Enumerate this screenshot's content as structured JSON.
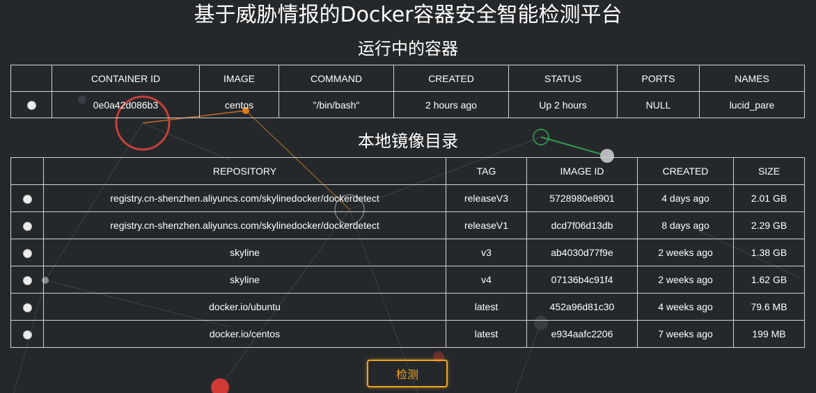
{
  "page": {
    "title": "基于威胁情报的Docker容器安全智能检测平台"
  },
  "containers": {
    "section_title": "运行中的容器",
    "headers": [
      "",
      "CONTAINER ID",
      "IMAGE",
      "COMMAND",
      "CREATED",
      "STATUS",
      "PORTS",
      "NAMES"
    ],
    "rows": [
      [
        "0e0a42d086b3",
        "centos",
        "\"/bin/bash\"",
        "2 hours ago",
        "Up 2 hours",
        "NULL",
        "lucid_pare"
      ]
    ]
  },
  "images": {
    "section_title": "本地镜像目录",
    "headers": [
      "",
      "REPOSITORY",
      "TAG",
      "IMAGE ID",
      "CREATED",
      "SIZE"
    ],
    "rows": [
      [
        "registry.cn-shenzhen.aliyuncs.com/skylinedocker/dockerdetect",
        "releaseV3",
        "5728980e8901",
        "4 days ago",
        "2.01 GB"
      ],
      [
        "registry.cn-shenzhen.aliyuncs.com/skylinedocker/dockerdetect",
        "releaseV1",
        "dcd7f06d13db",
        "8 days ago",
        "2.29 GB"
      ],
      [
        "skyline",
        "v3",
        "ab4030d77f9e",
        "2 weeks ago",
        "1.38 GB"
      ],
      [
        "skyline",
        "v4",
        "07136b4c91f4",
        "2 weeks ago",
        "1.62 GB"
      ],
      [
        "docker.io/ubuntu",
        "latest",
        "452a96d81c30",
        "4 weeks ago",
        "79.6 MB"
      ],
      [
        "docker.io/centos",
        "latest",
        "e934aafc2206",
        "7 weeks ago",
        "199 MB"
      ]
    ]
  },
  "actions": {
    "detect_label": "检测"
  },
  "colors": {
    "background": "#25282b",
    "accent": "#f5a623",
    "border": "#d2d4d6"
  }
}
